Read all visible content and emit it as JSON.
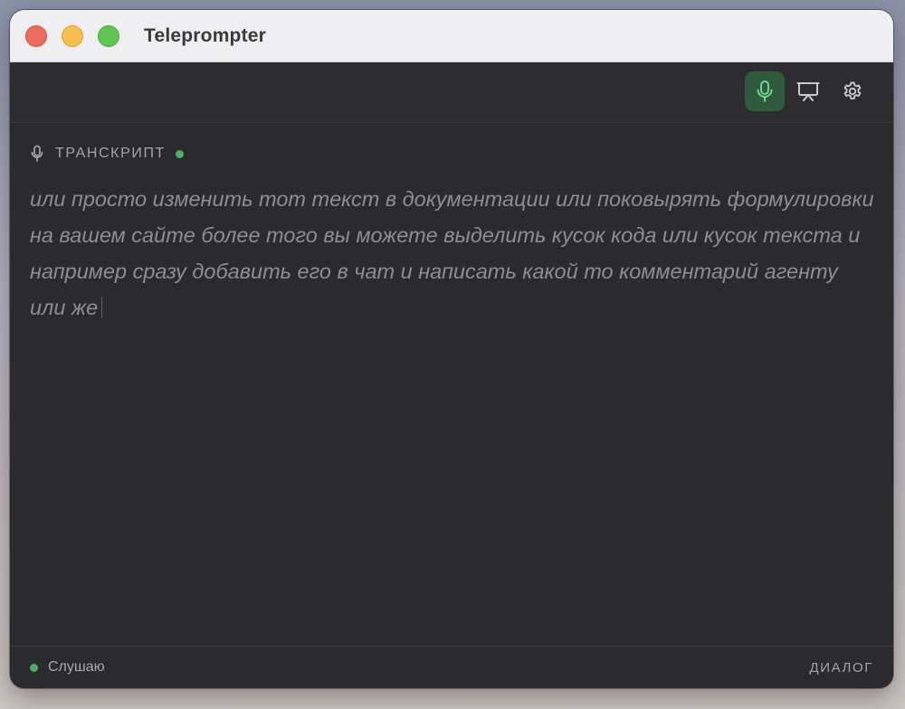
{
  "window": {
    "title": "Teleprompter"
  },
  "toolbar": {
    "buttons": [
      {
        "name": "microphone",
        "icon": "mic-icon",
        "active": true
      },
      {
        "name": "presentation",
        "icon": "presentation-icon",
        "active": false
      },
      {
        "name": "settings",
        "icon": "gear-icon",
        "active": false
      }
    ]
  },
  "transcript": {
    "header": "ТРАНСКРИПТ",
    "header_icon": "mic-icon",
    "live": true,
    "lines": [
      "или просто изменить тот текст в документации или поковырять формулировки",
      "на вашем сайте более того вы можете выделить кусок кода или кусок текста и",
      "например сразу добавить его в чат и написать какой то комментарий агенту",
      "или же"
    ]
  },
  "status": {
    "text": "Слушаю",
    "mode_label": "ДИАЛОГ"
  },
  "colors": {
    "accent_green": "#4caf62",
    "active_button_bg": "#2f5a3d",
    "background": "#2b2b2d"
  }
}
